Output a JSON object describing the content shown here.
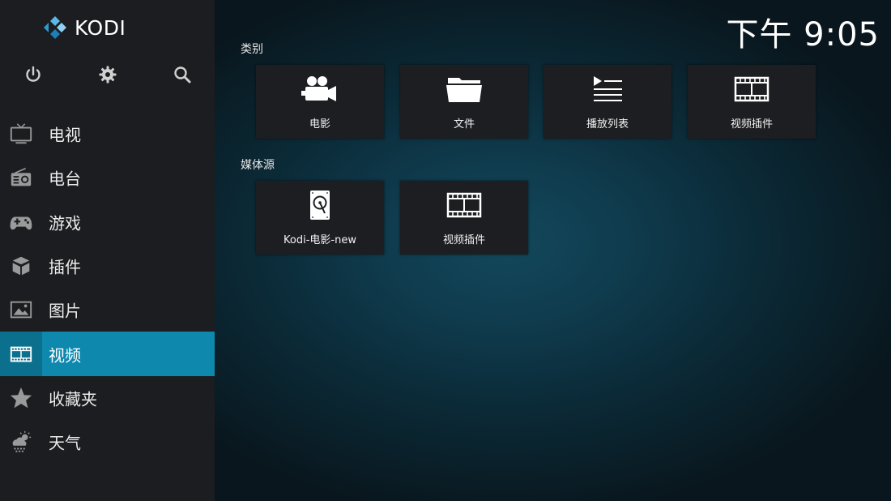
{
  "app": {
    "logo_text": "KODI",
    "clock": "下午 9:05"
  },
  "topbar": {
    "icons": [
      "power-icon",
      "settings-icon",
      "search-icon"
    ]
  },
  "sidebar": {
    "items": [
      {
        "label": "电视",
        "icon": "tv-icon",
        "active": false
      },
      {
        "label": "电台",
        "icon": "radio-icon",
        "active": false
      },
      {
        "label": "游戏",
        "icon": "gamepad-icon",
        "active": false
      },
      {
        "label": "插件",
        "icon": "addons-box-icon",
        "active": false
      },
      {
        "label": "图片",
        "icon": "pictures-icon",
        "active": false
      },
      {
        "label": "视频",
        "icon": "film-strip-icon",
        "active": true
      },
      {
        "label": "收藏夹",
        "icon": "star-icon",
        "active": false
      },
      {
        "label": "天气",
        "icon": "weather-icon",
        "active": false
      }
    ]
  },
  "main": {
    "categories_title": "类别",
    "categories": [
      {
        "label": "电影",
        "icon": "movie-camera-icon"
      },
      {
        "label": "文件",
        "icon": "folder-icon"
      },
      {
        "label": "播放列表",
        "icon": "playlist-icon"
      },
      {
        "label": "视频插件",
        "icon": "film-strip-icon"
      }
    ],
    "sources_title": "媒体源",
    "sources": [
      {
        "label": "Kodi-电影-new",
        "icon": "hard-drive-icon"
      },
      {
        "label": "视频插件",
        "icon": "film-strip-icon"
      }
    ]
  },
  "colors": {
    "sidebar_bg": "#1b1d20",
    "accent": "#0e88ad",
    "tile_bg": "#1c1e21"
  }
}
